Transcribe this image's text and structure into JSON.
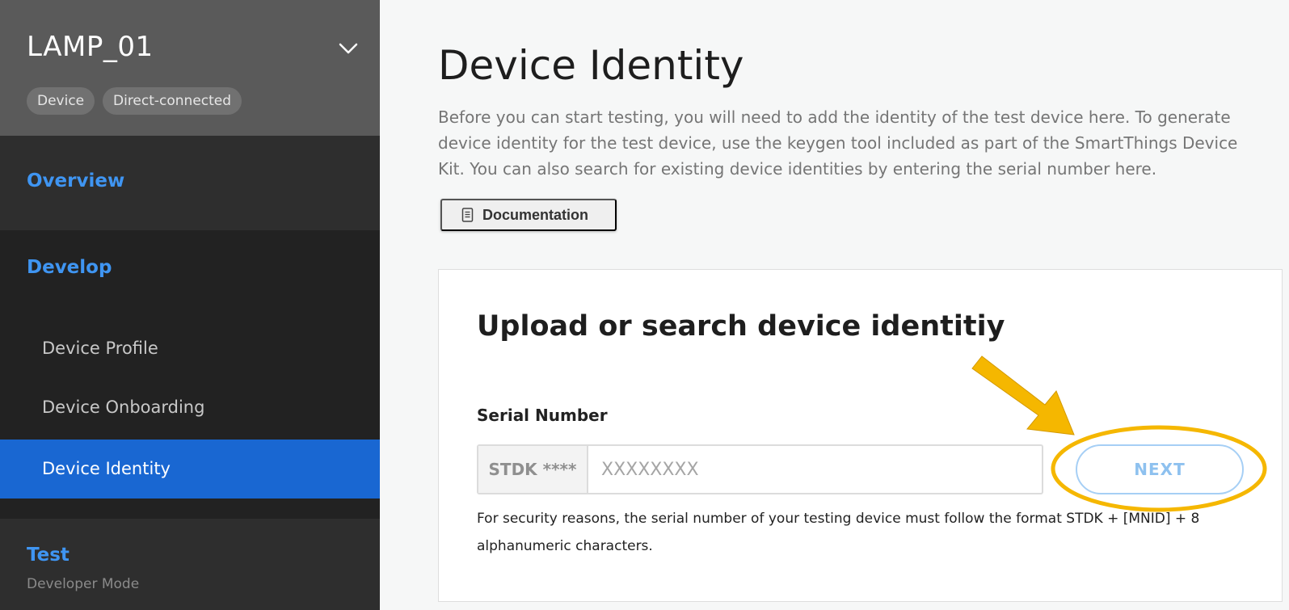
{
  "sidebar": {
    "device_name": "LAMP_01",
    "chips": [
      "Device",
      "Direct-connected"
    ],
    "overview_label": "Overview",
    "develop_label": "Develop",
    "develop_items": [
      "Device Profile",
      "Device Onboarding",
      "Device Identity"
    ],
    "active_item": "Device Identity",
    "test_label": "Test",
    "test_sub": "Developer Mode"
  },
  "main": {
    "title": "Device Identity",
    "description": "Before you can start testing, you will need to add the identity of the test device here. To generate device identity for the test device, use the keygen tool included as part of the SmartThings Device Kit. You can also search for existing device identities by entering the serial number here.",
    "doc_button": "Documentation",
    "card": {
      "title": "Upload or search device identitiy",
      "serial_label": "Serial Number",
      "prefix": "STDK ****",
      "placeholder": "XXXXXXXX",
      "next_button": "NEXT",
      "hint": "For security reasons, the serial number of your testing device must follow the format STDK + [MNID] + 8 alphanumeric characters."
    }
  },
  "colors": {
    "accent": "#1967d2",
    "link": "#3f95f2",
    "annotation": "#f5b700"
  }
}
